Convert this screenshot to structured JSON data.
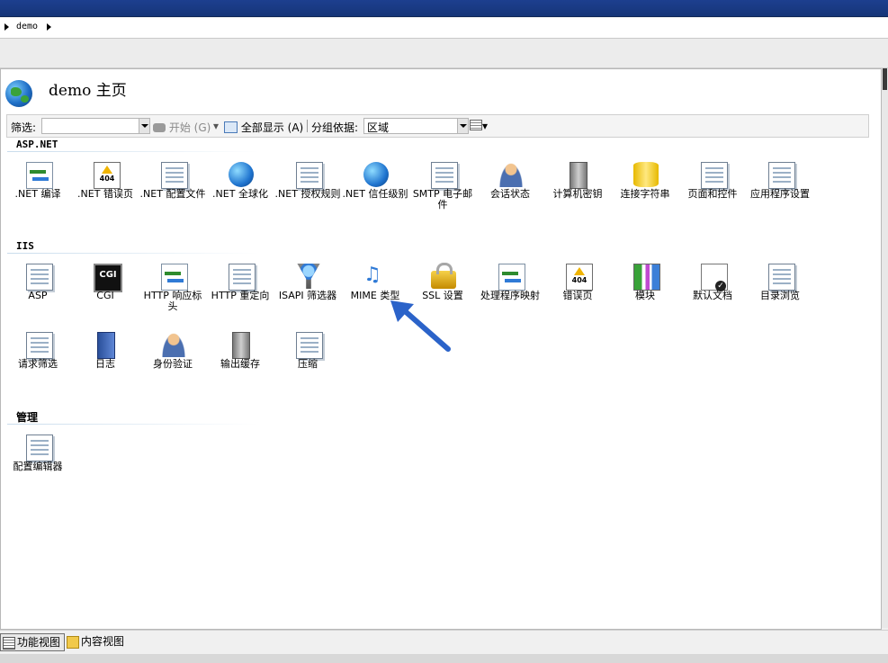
{
  "breadcrumb": {
    "items": [
      "demo"
    ]
  },
  "page": {
    "title": "demo 主页"
  },
  "filterbar": {
    "filter_label": "筛选:",
    "filter_value": "",
    "start_label": "开始 (G)",
    "show_all_label": "全部显示 (A)",
    "group_by_label": "分组依据:",
    "group_by_value": "区域"
  },
  "sections": {
    "aspnet": {
      "title": "ASP.NET",
      "items": [
        {
          "label": ".NET 编译",
          "icon": "compile-icon"
        },
        {
          "label": ".NET 错误页",
          "icon": "error-page-404-icon"
        },
        {
          "label": ".NET 配置文件",
          "icon": "profile-icon"
        },
        {
          "label": ".NET 全球化",
          "icon": "globe-icon"
        },
        {
          "label": ".NET 授权规则",
          "icon": "authorization-icon"
        },
        {
          "label": ".NET 信任级别",
          "icon": "trust-level-icon"
        },
        {
          "label": "SMTP 电子邮件",
          "icon": "smtp-email-icon"
        },
        {
          "label": "会话状态",
          "icon": "session-state-icon"
        },
        {
          "label": "计算机密钥",
          "icon": "machine-key-icon"
        },
        {
          "label": "连接字符串",
          "icon": "connection-string-icon"
        },
        {
          "label": "页面和控件",
          "icon": "pages-controls-icon"
        },
        {
          "label": "应用程序设置",
          "icon": "app-settings-icon"
        }
      ]
    },
    "iis": {
      "title": "IIS",
      "items": [
        {
          "label": "ASP",
          "icon": "asp-icon"
        },
        {
          "label": "CGI",
          "icon": "cgi-icon"
        },
        {
          "label": "HTTP 响应标头",
          "icon": "http-headers-icon"
        },
        {
          "label": "HTTP 重定向",
          "icon": "http-redirect-icon"
        },
        {
          "label": "ISAPI 筛选器",
          "icon": "isapi-filter-icon"
        },
        {
          "label": "MIME 类型",
          "icon": "mime-types-icon"
        },
        {
          "label": "SSL 设置",
          "icon": "ssl-lock-icon"
        },
        {
          "label": "处理程序映射",
          "icon": "handler-mappings-icon"
        },
        {
          "label": "错误页",
          "icon": "error-pages-icon"
        },
        {
          "label": "模块",
          "icon": "modules-icon"
        },
        {
          "label": "默认文档",
          "icon": "default-document-icon"
        },
        {
          "label": "目录浏览",
          "icon": "directory-browsing-icon"
        },
        {
          "label": "请求筛选",
          "icon": "request-filtering-icon"
        },
        {
          "label": "日志",
          "icon": "logging-icon"
        },
        {
          "label": "身份验证",
          "icon": "authentication-icon"
        },
        {
          "label": "输出缓存",
          "icon": "output-caching-icon"
        },
        {
          "label": "压缩",
          "icon": "compression-icon"
        }
      ]
    },
    "management": {
      "title": "管理",
      "items": [
        {
          "label": "配置编辑器",
          "icon": "configuration-editor-icon"
        }
      ]
    }
  },
  "bottom_tabs": {
    "features_view": "功能视图",
    "content_view": "内容视图"
  },
  "colors": {
    "titlebar": "#1d3f8f",
    "annotation_arrow": "#2b63c9"
  }
}
